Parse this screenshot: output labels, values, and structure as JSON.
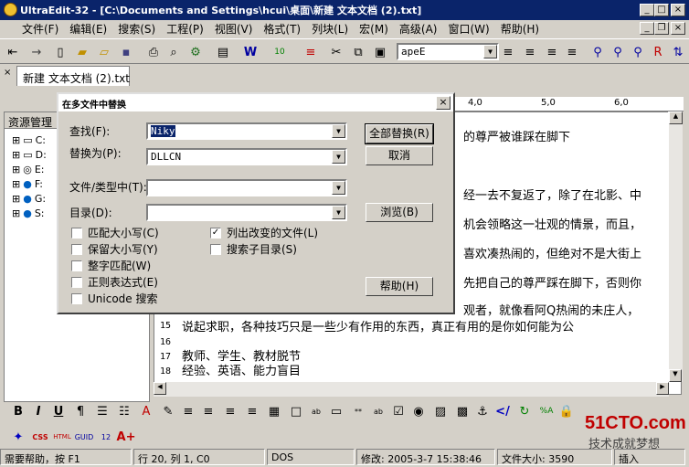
{
  "window": {
    "title": "UltraEdit-32 - [C:\\Documents and Settings\\hcui\\桌面\\新建 文本文档 (2).txt]"
  },
  "menu": [
    "文件(F)",
    "编辑(E)",
    "搜索(S)",
    "工程(P)",
    "视图(V)",
    "格式(T)",
    "列块(L)",
    "宏(M)",
    "高级(A)",
    "窗口(W)",
    "帮助(H)"
  ],
  "toolbar": {
    "font_value": "apeE"
  },
  "tab": {
    "label": "新建 文本文档 (2).txt"
  },
  "explorer": {
    "header": "资源管理",
    "drives": [
      "C:",
      "D:",
      "E:",
      "F:",
      "G:",
      "S:"
    ]
  },
  "ruler": {
    "marks": [
      "4,0",
      "5,0",
      "6,0"
    ]
  },
  "editor": {
    "lines": [
      {
        "num": "",
        "text": "的尊严被谁踩在脚下"
      },
      {
        "num": "",
        "text": "经一去不复返了，除了在北影、中"
      },
      {
        "num": "",
        "text": "机会领略这一壮观的情景，而且，"
      },
      {
        "num": "",
        "text": "喜欢凑热闹的，但绝对不是大街上"
      },
      {
        "num": "",
        "text": "先把自己的尊严踩在脚下，否则你"
      },
      {
        "num": "",
        "text": "观者，就像看阿Q热闹的未庄人，"
      },
      {
        "num": "15",
        "text": "  说起求职，各种技巧只是一些少有作用的东西，真正有用的是你如何能为公"
      },
      {
        "num": "16",
        "text": ""
      },
      {
        "num": "17",
        "text": "教师、学生、教材脱节"
      },
      {
        "num": "18",
        "text": "经验、英语、能力盲目"
      }
    ]
  },
  "dialog": {
    "title": "在多文件中替换",
    "find_label": "查找(F):",
    "find_value": "Niky",
    "replace_label": "替换为(P):",
    "replace_value": "DLLCN",
    "filetype_label": "文件/类型中(T):",
    "filetype_value": "",
    "dir_label": "目录(D):",
    "dir_value": "",
    "btn_replace_all": "全部替换(R)",
    "btn_cancel": "取消",
    "btn_browse": "浏览(B)",
    "btn_help": "帮助(H)",
    "options": [
      {
        "label": "匹配大小写(C)",
        "checked": false
      },
      {
        "label": "保留大小写(Y)",
        "checked": false
      },
      {
        "label": "整字匹配(W)",
        "checked": false
      },
      {
        "label": "正则表达式(E)",
        "checked": false
      },
      {
        "label": "Unicode 搜索",
        "checked": false
      }
    ],
    "options_right": [
      {
        "label": "列出改变的文件(L)",
        "checked": true
      },
      {
        "label": "搜索子目录(S)",
        "checked": false
      }
    ]
  },
  "statusbar": {
    "help": "需要帮助，按 F1",
    "position": "行 20, 列 1, C0",
    "format": "DOS",
    "modified": "修改: 2005-3-7 15:38:46",
    "filesize": "文件大小: 3590",
    "mode": "插入"
  },
  "watermark": {
    "brand": "51CTO.com",
    "slogan": "技术成就梦想"
  }
}
